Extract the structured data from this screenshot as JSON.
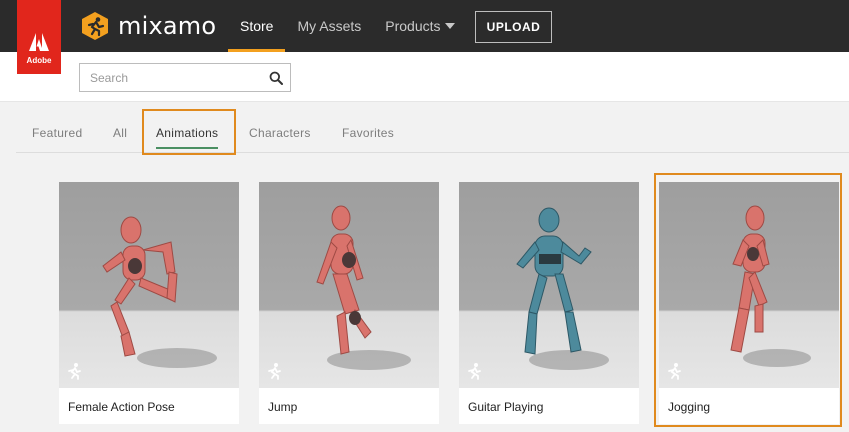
{
  "header": {
    "adobe_label": "Adobe",
    "brand_name": "mixamo",
    "nav": [
      {
        "label": "Store",
        "active": true
      },
      {
        "label": "My Assets",
        "active": false
      },
      {
        "label": "Products",
        "active": false
      }
    ],
    "upload_label": "UPLOAD"
  },
  "search": {
    "placeholder": "Search",
    "value": ""
  },
  "tabs": [
    {
      "label": "Featured",
      "active": false
    },
    {
      "label": "All",
      "active": false
    },
    {
      "label": "Animations",
      "active": true
    },
    {
      "label": "Characters",
      "active": false
    },
    {
      "label": "Favorites",
      "active": false
    }
  ],
  "cards": [
    {
      "label": "Female Action Pose",
      "character_color": "#d9736c",
      "icon": "running-figure-icon"
    },
    {
      "label": "Jump",
      "character_color": "#d9736c",
      "icon": "running-figure-icon"
    },
    {
      "label": "Guitar Playing",
      "character_color": "#4d8a9c",
      "icon": "running-figure-icon"
    },
    {
      "label": "Jogging",
      "character_color": "#d9736c",
      "icon": "running-figure-icon",
      "highlighted": true
    }
  ],
  "colors": {
    "topbar": "#2b2b2b",
    "adobe_red": "#e1261c",
    "accent_orange": "#f3a01f",
    "highlight_orange": "#e08a1e",
    "tab_underline": "#4a8f62"
  }
}
